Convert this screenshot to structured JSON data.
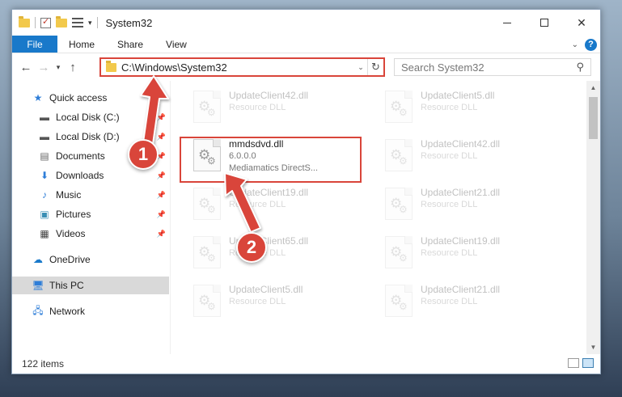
{
  "window": {
    "title": "System32"
  },
  "ribbon": {
    "tabs": [
      "File",
      "Home",
      "Share",
      "View"
    ],
    "help_label": "?"
  },
  "navbar": {
    "address_path": "C:\\Windows\\System32",
    "search_placeholder": "Search System32"
  },
  "sidebar": {
    "items": [
      {
        "label": "Quick access",
        "icon": "star-icon"
      },
      {
        "label": "Local Disk (C:)",
        "icon": "drive-icon",
        "pinned": true
      },
      {
        "label": "Local Disk (D:)",
        "icon": "drive-icon",
        "pinned": true
      },
      {
        "label": "Documents",
        "icon": "documents-icon",
        "pinned": true
      },
      {
        "label": "Downloads",
        "icon": "download-icon",
        "pinned": true
      },
      {
        "label": "Music",
        "icon": "music-icon",
        "pinned": true
      },
      {
        "label": "Pictures",
        "icon": "pictures-icon",
        "pinned": true
      },
      {
        "label": "Videos",
        "icon": "videos-icon",
        "pinned": true
      },
      {
        "label": "OneDrive",
        "icon": "cloud-icon"
      },
      {
        "label": "This PC",
        "icon": "computer-icon",
        "selected": true
      },
      {
        "label": "Network",
        "icon": "network-icon"
      }
    ]
  },
  "files": {
    "left_column": [
      {
        "name": "UpdateClient42.dll",
        "sub": "Resource DLL",
        "faded": true
      },
      {
        "name": "mmdsdvd.dll",
        "version": "6.0.0.0",
        "sub": "Mediamatics DirectS...",
        "faded": false
      },
      {
        "name": "UpdateClient19.dll",
        "sub": "Resource DLL",
        "faded": true
      },
      {
        "name": "UpdateClient65.dll",
        "sub": "Resource DLL",
        "faded": true
      },
      {
        "name": "UpdateClient5.dll",
        "sub": "Resource DLL",
        "faded": true
      }
    ],
    "right_column": [
      {
        "name": "UpdateClient5.dll",
        "sub": "Resource DLL",
        "faded": true
      },
      {
        "name": "UpdateClient42.dll",
        "sub": "Resource DLL",
        "faded": true
      },
      {
        "name": "UpdateClient21.dll",
        "sub": "Resource DLL",
        "faded": true
      },
      {
        "name": "UpdateClient19.dll",
        "sub": "Resource DLL",
        "faded": true
      },
      {
        "name": "UpdateClient21.dll",
        "sub": "Resource DLL",
        "faded": true
      }
    ]
  },
  "status": {
    "item_count": "122 items"
  },
  "callouts": {
    "one": "1",
    "two": "2"
  },
  "colors": {
    "accent": "#1979ca",
    "highlight": "#d9453a"
  }
}
